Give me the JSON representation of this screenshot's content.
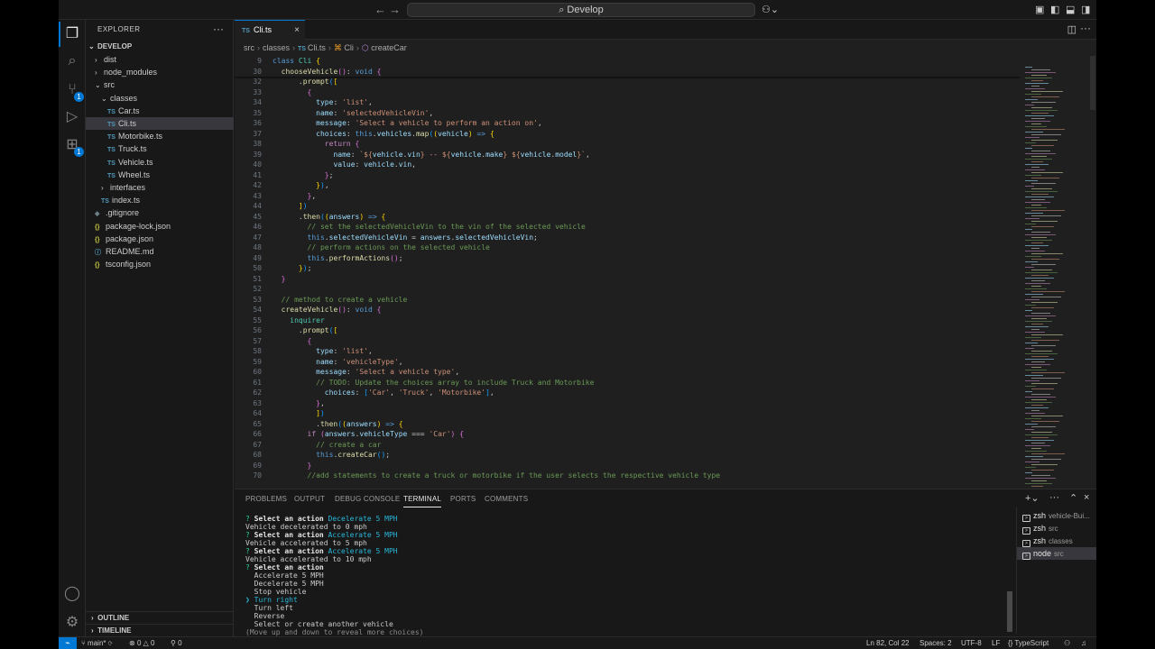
{
  "titlebar": {
    "back": "←",
    "forward": "→",
    "search_text": "Develop",
    "copilot": "⚇⌄"
  },
  "sidebar": {
    "title": "EXPLORER",
    "more": "···",
    "root": "DEVELOP",
    "tree": [
      {
        "label": "dist",
        "kind": "folder",
        "depth": 1,
        "open": false
      },
      {
        "label": "node_modules",
        "kind": "folder",
        "depth": 1,
        "open": false
      },
      {
        "label": "src",
        "kind": "folder",
        "depth": 1,
        "open": true
      },
      {
        "label": "classes",
        "kind": "folder",
        "depth": 2,
        "open": true
      },
      {
        "label": "Car.ts",
        "kind": "ts",
        "depth": 3
      },
      {
        "label": "Cli.ts",
        "kind": "ts",
        "depth": 3,
        "selected": true
      },
      {
        "label": "Motorbike.ts",
        "kind": "ts",
        "depth": 3
      },
      {
        "label": "Truck.ts",
        "kind": "ts",
        "depth": 3
      },
      {
        "label": "Vehicle.ts",
        "kind": "ts",
        "depth": 3
      },
      {
        "label": "Wheel.ts",
        "kind": "ts",
        "depth": 3
      },
      {
        "label": "interfaces",
        "kind": "folder",
        "depth": 2,
        "open": false
      },
      {
        "label": "index.ts",
        "kind": "ts",
        "depth": 2
      },
      {
        "label": ".gitignore",
        "kind": "git",
        "depth": 1
      },
      {
        "label": "package-lock.json",
        "kind": "json",
        "depth": 1
      },
      {
        "label": "package.json",
        "kind": "json",
        "depth": 1
      },
      {
        "label": "README.md",
        "kind": "md",
        "depth": 1
      },
      {
        "label": "tsconfig.json",
        "kind": "json",
        "depth": 1
      }
    ],
    "outline": "OUTLINE",
    "timeline": "TIMELINE",
    "scm_badge": "1",
    "ext_badge": "1"
  },
  "editor": {
    "tab_label": "Cli.ts",
    "tab_tag": "TS",
    "breadcrumb": [
      "src",
      "classes",
      "Cli.ts",
      "Cli",
      "createCar"
    ],
    "lines": [
      {
        "n": "9",
        "h": "<span class='kb'>class</span> <span class='t'>Cli</span> <span class='b1'>{</span>"
      },
      {
        "n": "30",
        "h": "  <span class='f'>chooseVehicle</span><span class='b2'>()</span>: <span class='kb'>void</span> <span class='b2'>{</span>"
      },
      {
        "n": "32",
        "h": "      .<span class='f'>prompt</span><span class='b3'>(</span><span class='b1'>[</span>"
      },
      {
        "n": "33",
        "h": "        <span class='b2'>{</span>"
      },
      {
        "n": "34",
        "h": "          <span class='p'>type</span>: <span class='s'>'list'</span>,"
      },
      {
        "n": "35",
        "h": "          <span class='p'>name</span>: <span class='s'>'selectedVehicleVin'</span>,"
      },
      {
        "n": "36",
        "h": "          <span class='p'>message</span>: <span class='s'>'Select a vehicle to perform an action on'</span>,"
      },
      {
        "n": "37",
        "h": "          <span class='p'>choices</span>: <span class='kb'>this</span>.<span class='p'>vehicles</span>.<span class='f'>map</span><span class='b3'>(</span><span class='b1'>(</span><span class='p'>vehicle</span><span class='b1'>)</span> <span class='kb'>=></span> <span class='b1'>{</span>"
      },
      {
        "n": "38",
        "h": "            <span class='k'>return</span> <span class='b2'>{</span>"
      },
      {
        "n": "39",
        "h": "              <span class='p'>name</span>: <span class='s'>`${</span><span class='p'>vehicle</span>.<span class='p'>vin</span><span class='s'>}</span> <span class='s'>--</span> <span class='s'>${</span><span class='p'>vehicle</span>.<span class='p'>make</span><span class='s'>}</span> <span class='s'>${</span><span class='p'>vehicle</span>.<span class='p'>model</span><span class='s'>}`</span>,"
      },
      {
        "n": "40",
        "h": "              <span class='p'>value</span>: <span class='p'>vehicle</span>.<span class='p'>vin</span>,"
      },
      {
        "n": "41",
        "h": "            <span class='b2'>}</span>;"
      },
      {
        "n": "42",
        "h": "          <span class='b1'>}</span><span class='b3'>)</span>,"
      },
      {
        "n": "43",
        "h": "        <span class='b2'>}</span>,"
      },
      {
        "n": "44",
        "h": "      <span class='b1'>]</span><span class='b3'>)</span>"
      },
      {
        "n": "45",
        "h": "      .<span class='f'>then</span><span class='b3'>(</span><span class='b1'>(</span><span class='p'>answers</span><span class='b1'>)</span> <span class='kb'>=></span> <span class='b1'>{</span>"
      },
      {
        "n": "46",
        "h": "        <span class='c'>// set the selectedVehicleVin to the vin of the selected vehicle</span>"
      },
      {
        "n": "47",
        "h": "        <span class='kb'>this</span>.<span class='p'>selectedVehicleVin</span> = <span class='p'>answers</span>.<span class='p'>selectedVehicleVin</span>;"
      },
      {
        "n": "48",
        "h": "        <span class='c'>// perform actions on the selected vehicle</span>"
      },
      {
        "n": "49",
        "h": "        <span class='kb'>this</span>.<span class='f'>performActions</span><span class='b2'>()</span>;"
      },
      {
        "n": "50",
        "h": "      <span class='b1'>}</span><span class='b3'>)</span>;"
      },
      {
        "n": "51",
        "h": "  <span class='b2'>}</span>"
      },
      {
        "n": "52",
        "h": ""
      },
      {
        "n": "53",
        "h": "  <span class='c'>// method to create a vehicle</span>"
      },
      {
        "n": "54",
        "h": "  <span class='f'>createVehicle</span><span class='b2'>()</span>: <span class='kb'>void</span> <span class='b2'>{</span>"
      },
      {
        "n": "55",
        "h": "    <span class='t'>inquirer</span>"
      },
      {
        "n": "56",
        "h": "      .<span class='f'>prompt</span><span class='b3'>(</span><span class='b1'>[</span>"
      },
      {
        "n": "57",
        "h": "        <span class='b2'>{</span>"
      },
      {
        "n": "58",
        "h": "          <span class='p'>type</span>: <span class='s'>'list'</span>,"
      },
      {
        "n": "59",
        "h": "          <span class='p'>name</span>: <span class='s'>'vehicleType'</span>,"
      },
      {
        "n": "60",
        "h": "          <span class='p'>message</span>: <span class='s'>'Select a vehicle type'</span>,"
      },
      {
        "n": "61",
        "h": "          <span class='c'>// TODO: Update the choices array to include Truck and Motorbike</span>"
      },
      {
        "n": "62",
        "h": "            <span class='p'>choices</span>: <span class='b3'>[</span><span class='s'>'Car'</span>, <span class='s'>'Truck'</span>, <span class='s'>'Motorbike'</span><span class='b3'>]</span>,"
      },
      {
        "n": "63",
        "h": "          <span class='b2'>}</span>,"
      },
      {
        "n": "64",
        "h": "          <span class='b1'>]</span><span class='b3'>)</span>"
      },
      {
        "n": "65",
        "h": "          .<span class='f'>then</span><span class='b3'>(</span><span class='b1'>(</span><span class='p'>answers</span><span class='b1'>)</span> <span class='kb'>=></span> <span class='b1'>{</span>"
      },
      {
        "n": "66",
        "h": "        <span class='k'>if</span> <span class='b2'>(</span><span class='p'>answers</span>.<span class='p'>vehicleType</span> === <span class='s'>'Car'</span><span class='b2'>)</span> <span class='b2'>{</span>"
      },
      {
        "n": "67",
        "h": "          <span class='c'>// create a car</span>"
      },
      {
        "n": "68",
        "h": "          <span class='kb'>this</span>.<span class='f'>createCar</span><span class='b3'>()</span>;"
      },
      {
        "n": "69",
        "h": "        <span class='b2'>}</span>"
      },
      {
        "n": "70",
        "h": "        <span class='c'>//add statements to create a truck or motorbike if the user selects the respective vehicle type</span>"
      }
    ]
  },
  "panel": {
    "tabs": [
      "PROBLEMS",
      "OUTPUT",
      "DEBUG CONSOLE",
      "TERMINAL",
      "PORTS",
      "COMMENTS"
    ],
    "active_tab": "TERMINAL",
    "terminal_lines": [
      {
        "h": "<span class='q'>?</span> <span class='bold'>Select an action</span> <span class='cy'>Decelerate 5 MPH</span>"
      },
      {
        "h": "Vehicle decelerated to 0 mph"
      },
      {
        "h": "<span class='q'>?</span> <span class='bold'>Select an action</span> <span class='cy'>Accelerate 5 MPH</span>"
      },
      {
        "h": "Vehicle accelerated to 5 mph"
      },
      {
        "h": "<span class='q'>?</span> <span class='bold'>Select an action</span> <span class='cy'>Accelerate 5 MPH</span>"
      },
      {
        "h": "Vehicle accelerated to 10 mph"
      },
      {
        "h": "<span class='q'>?</span> <span class='bold'>Select an action</span>"
      },
      {
        "h": "  Accelerate 5 MPH"
      },
      {
        "h": "  Decelerate 5 MPH"
      },
      {
        "h": "  Stop vehicle"
      },
      {
        "h": "<span class='cy'>❯ Turn right</span>"
      },
      {
        "h": "  Turn left"
      },
      {
        "h": "  Reverse"
      },
      {
        "h": "  Select or create another vehicle"
      },
      {
        "h": "<span class='dim'>(Move up and down to reveal more choices)</span>"
      }
    ],
    "terminals": [
      {
        "shell": "zsh",
        "cwd": "vehicle-Bui..."
      },
      {
        "shell": "zsh",
        "cwd": "src"
      },
      {
        "shell": "zsh",
        "cwd": "classes"
      },
      {
        "shell": "node",
        "cwd": "src",
        "selected": true
      }
    ]
  },
  "statusbar": {
    "branch": "main*",
    "errors": "0",
    "warnings": "0",
    "ports": "0",
    "cursor": "Ln 82, Col 22",
    "spaces": "Spaces: 2",
    "encoding": "UTF-8",
    "eol": "LF",
    "language": "TypeScript"
  },
  "colors": {
    "accent": "#0078d4",
    "background": "#181818",
    "editor_bg": "#1f1f1f"
  }
}
